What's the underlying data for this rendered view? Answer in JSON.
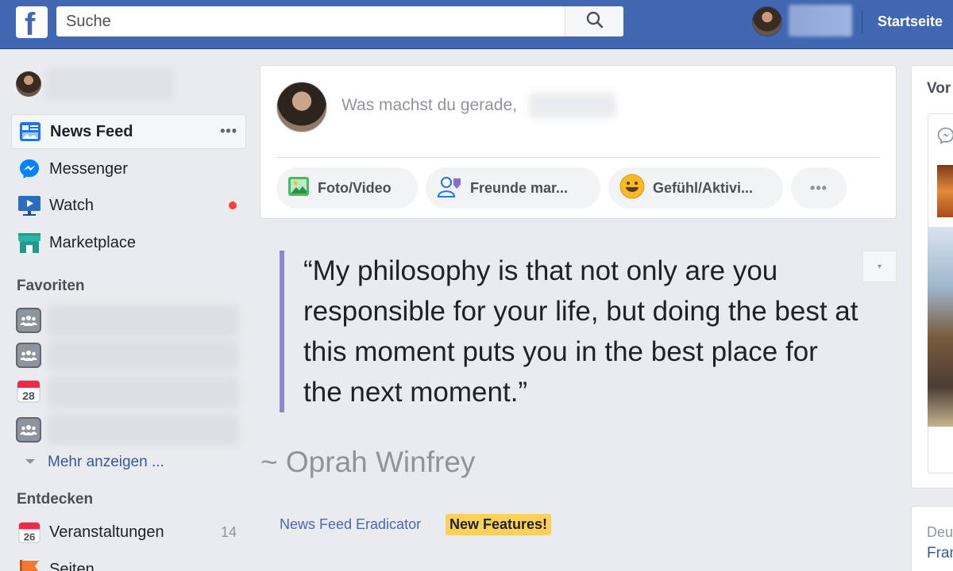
{
  "topbar": {
    "logo_letter": "f",
    "search_placeholder": "Suche",
    "home_label": "Startseite"
  },
  "sidebar": {
    "nav": [
      {
        "label": "News Feed",
        "icon": "news-feed-icon",
        "active": true
      },
      {
        "label": "Messenger",
        "icon": "messenger-icon"
      },
      {
        "label": "Watch",
        "icon": "watch-icon",
        "badge": "red-dot"
      },
      {
        "label": "Marketplace",
        "icon": "marketplace-icon"
      }
    ],
    "news_feed_more": "•••",
    "favorites_title": "Favoriten",
    "favorites_calendar_day": "28",
    "show_more_label": "Mehr anzeigen ...",
    "explore_title": "Entdecken",
    "explore": [
      {
        "label": "Veranstaltungen",
        "icon": "calendar-icon",
        "count": "14",
        "calendar_day": "26"
      },
      {
        "label": "Seiten",
        "icon": "flag-icon"
      }
    ]
  },
  "composer": {
    "placeholder": "Was machst du gerade,",
    "actions": [
      {
        "label": "Foto/Video",
        "icon": "photo-icon"
      },
      {
        "label": "Freunde mar...",
        "icon": "tag-friends-icon"
      },
      {
        "label": "Gefühl/Aktivi...",
        "icon": "emoji-icon"
      },
      {
        "label": "•••",
        "icon": "more-icon"
      }
    ]
  },
  "quote": {
    "text": "“My philosophy is that not only are you responsible for your life, but doing the best at this moment puts you in the best place for the next moment.”",
    "author": "~ Oprah Winfrey",
    "chevron": "▾",
    "extension_link": "News Feed Eradicator",
    "new_features": "New Features!"
  },
  "right": {
    "card_title": "Vor",
    "card2_line1": "Deu",
    "card2_line2": "Fran"
  },
  "colors": {
    "topbar": "#4267b2",
    "background": "#e9ebee",
    "link": "#385898",
    "quote_bar": "#8b8ad0",
    "highlight": "#fcd15a"
  }
}
